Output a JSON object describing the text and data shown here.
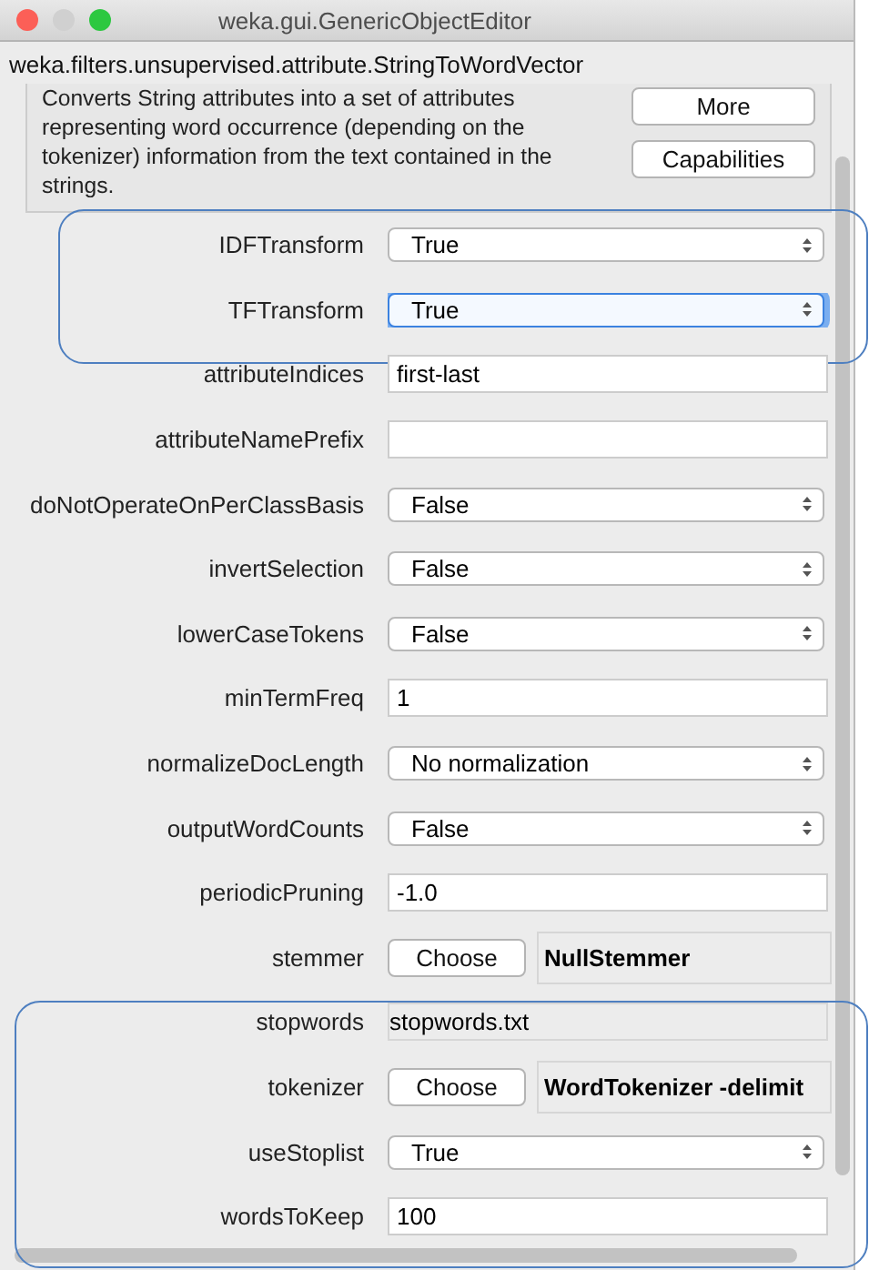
{
  "window": {
    "title": "weka.gui.GenericObjectEditor"
  },
  "class_name": "weka.filters.unsupervised.attribute.StringToWordVector",
  "description": "Converts String attributes into a set of attributes representing word occurrence (depending on the tokenizer) information from the text contained in the strings.",
  "side_buttons": [
    "More",
    "Capabilities"
  ],
  "property_groups": [
    {
      "highlighted": true,
      "properties": [
        {
          "label": "IDFTransform",
          "kind": "dropdown",
          "value": "True",
          "focused": false
        },
        {
          "label": "TFTransform",
          "kind": "dropdown",
          "value": "True",
          "focused": true
        }
      ]
    },
    {
      "highlighted": false,
      "properties": [
        {
          "label": "attributeIndices",
          "kind": "text",
          "value": "first-last"
        },
        {
          "label": "attributeNamePrefix",
          "kind": "text"
        },
        {
          "label": "doNotOperateOnPerClassBasis",
          "kind": "dropdown",
          "value": "False",
          "focused": false
        },
        {
          "label": "invertSelection",
          "kind": "dropdown",
          "value": "False",
          "focused": false
        },
        {
          "label": "lowerCaseTokens",
          "kind": "dropdown",
          "value": "False",
          "focused": false
        },
        {
          "label": "minTermFreq",
          "kind": "text",
          "value": "1"
        },
        {
          "label": "normalizeDocLength",
          "kind": "dropdown",
          "value": "No normalization",
          "focused": false
        },
        {
          "label": "outputWordCounts",
          "kind": "dropdown",
          "value": "False",
          "focused": false
        },
        {
          "label": "periodicPruning",
          "kind": "text",
          "value": "-1.0"
        },
        {
          "label": "stemmer",
          "kind": "chooser",
          "button": "Choose",
          "value": "NullStemmer"
        }
      ]
    },
    {
      "highlighted": true,
      "properties": [
        {
          "label": "stopwords",
          "kind": "file",
          "value": "stopwords.txt"
        },
        {
          "label": "tokenizer",
          "kind": "chooser",
          "button": "Choose",
          "value": "WordTokenizer -delimit"
        },
        {
          "label": "useStoplist",
          "kind": "dropdown",
          "value": "True",
          "focused": false
        },
        {
          "label": "wordsToKeep",
          "kind": "text",
          "value": "100"
        }
      ]
    }
  ]
}
